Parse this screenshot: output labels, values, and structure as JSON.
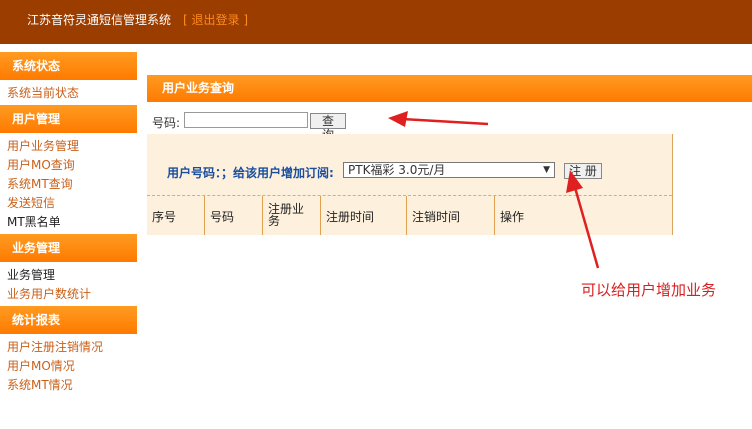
{
  "header": {
    "title": "江苏音符灵通短信管理系统",
    "bracket_open": "[",
    "logout_label": "退出登录",
    "bracket_close": "]"
  },
  "sidebar": {
    "sections": [
      {
        "title": "系统状态",
        "items": [
          "系统当前状态"
        ]
      },
      {
        "title": "用户管理",
        "items": [
          "用户业务管理",
          "用户MO查询",
          "系统MT查询",
          "发送短信",
          "MT黑名单"
        ]
      },
      {
        "title": "业务管理",
        "items": [
          "业务管理",
          "业务用户数统计"
        ]
      },
      {
        "title": "统计报表",
        "items": [
          "用户注册注销情况",
          "用户MO情况",
          "系统MT情况"
        ]
      }
    ]
  },
  "main": {
    "panel_title": "用户业务查询",
    "search": {
      "label": "号码:",
      "value": "",
      "button": "查 询"
    },
    "register": {
      "label": "用户号码：；给该用户增加订阅:",
      "selected_option": "PTK福彩 3.0元/月",
      "button": "注 册"
    },
    "table": {
      "columns": [
        "序号",
        "号码",
        "注册业务",
        "注册时间",
        "注销时间",
        "操作"
      ]
    }
  },
  "annotation": {
    "text": "可以给用户增加业务",
    "color": "#d81e1e"
  },
  "colors": {
    "header_bg": "#9c3d00",
    "accent_orange": "#ff8a1a",
    "label_blue": "#1a4fa0",
    "panel_bg": "#fdf0dc"
  }
}
